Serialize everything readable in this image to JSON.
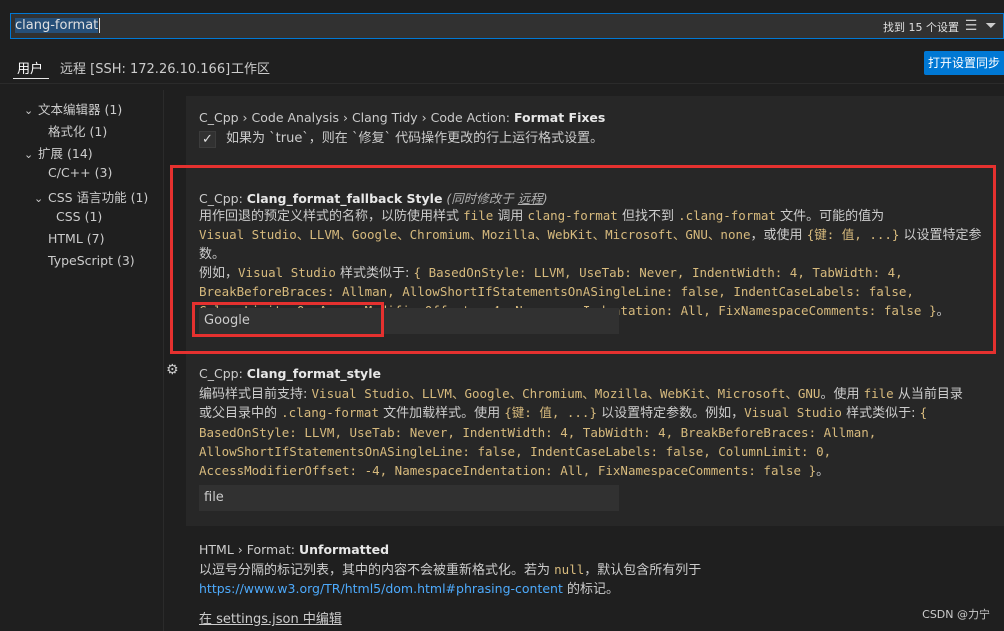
{
  "search": {
    "query": "clang-format",
    "count_text": "找到 15 个设置"
  },
  "icons": {
    "clear_filter": "list-filter-icon",
    "filter": "funnel-icon",
    "checkbox": "check-icon",
    "gear": "gear-icon"
  },
  "tabs": [
    {
      "label": "用户"
    },
    {
      "label": "远程 [SSH: 172.26.10.166]"
    },
    {
      "label": "工作区"
    }
  ],
  "sync_button": "打开设置同步",
  "toc": {
    "items": [
      {
        "label": "文本编辑器",
        "count": "(1)"
      },
      {
        "label": "格式化",
        "count": "(1)"
      },
      {
        "label": "扩展",
        "count": "(14)"
      },
      {
        "label": "C/C++",
        "count": "(3)"
      },
      {
        "label": "CSS 语言功能",
        "count": "(1)"
      },
      {
        "label": "CSS",
        "count": "(1)"
      },
      {
        "label": "HTML",
        "count": "(7)"
      },
      {
        "label": "TypeScript",
        "count": "(3)"
      }
    ]
  },
  "settings": {
    "s1": {
      "prefix": "C_Cpp › Code Analysis › Clang Tidy › Code Action: ",
      "name": "Format Fixes",
      "desc_a": "如果为 `true`，则在 `修复` 代码操作更改的行上运行格式设置。",
      "checked": true
    },
    "s2": {
      "prefix": "C_Cpp: ",
      "name": "Clang_format_fallback Style",
      "modified_note": "(同时修改于 ",
      "modified_link": "远程",
      "modified_end": ")",
      "d1": "用作回退的预定义样式的名称，以防使用样式 ",
      "d1c1": "file",
      "d1b": " 调用 ",
      "d1c2": "clang-format",
      "d1d": " 但找不到 ",
      "d1c3": ".clang-format",
      "d1e": " 文件。可能的值为 ",
      "d2c": "Visual Studio、LLVM、Google、Chromium、Mozilla、WebKit、Microsoft、GNU、none",
      "d2b": "，或使用 ",
      "d2c2": "{键: 值, ...}",
      "d2e": " 以设置特定参数。",
      "d3": "例如，",
      "d3c": "Visual Studio",
      "d3b": " 样式类似于: ",
      "d3c2": "{ BasedOnStyle: LLVM, UseTab: Never, IndentWidth: 4, TabWidth: 4,",
      "d4c": "BreakBeforeBraces: Allman, AllowShortIfStatementsOnASingleLine: false, IndentCaseLabels: false,",
      "d5c": "ColumnLimit: 0, AccessModifierOffset: -4, NamespaceIndentation: All, FixNamespaceComments: false }",
      "d5e": "。",
      "value": "Google"
    },
    "s3": {
      "prefix": "C_Cpp: ",
      "name": "Clang_format_style",
      "d1": "编码样式目前支持: ",
      "d1c": "Visual Studio、LLVM、Google、Chromium、Mozilla、WebKit、Microsoft、GNU",
      "d1b": "。使用 ",
      "d1c2": "file",
      "d1e": " 从当前目录",
      "d2": "或父目录中的 ",
      "d2c": ".clang-format",
      "d2b": " 文件加载样式。使用 ",
      "d2c2": "{键: 值, ...}",
      "d2d": " 以设置特定参数。例如，",
      "d2c3": "Visual Studio",
      "d2e": " 样式类似于: ",
      "d2c4": "{",
      "d3c": "BasedOnStyle: LLVM, UseTab: Never, IndentWidth: 4, TabWidth: 4, BreakBeforeBraces: Allman,",
      "d4c": "AllowShortIfStatementsOnASingleLine: false, IndentCaseLabels: false, ColumnLimit: 0,",
      "d5c": "AccessModifierOffset: -4, NamespaceIndentation: All, FixNamespaceComments: false }",
      "d5e": "。",
      "value": "file"
    },
    "s4": {
      "prefix": "HTML › Format: ",
      "name": "Unformatted",
      "d1": "以逗号分隔的标记列表，其中的内容不会被重新格式化。若为 ",
      "d1c": "null",
      "d1b": "，默认包含所有列于",
      "link": "https://www.w3.org/TR/html5/dom.html#phrasing-content",
      "d2b": " 的标记。",
      "edit_link": "在 settings.json 中编辑"
    }
  },
  "watermark": "CSDN @力宁",
  "colors": {
    "accent": "#0078d4",
    "highlight_box": "#e5312f",
    "code": "#d7ba7d",
    "link": "#4daafc"
  }
}
